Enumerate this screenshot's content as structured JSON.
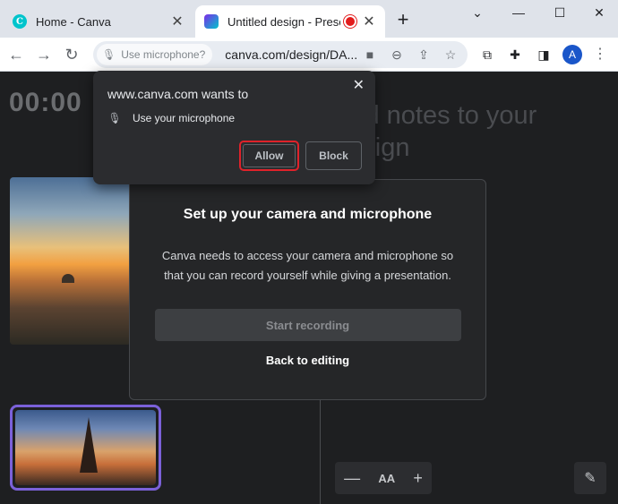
{
  "browser": {
    "tabs": [
      {
        "title": "Home - Canva",
        "favicon": "canva-logo-icon",
        "active": false
      },
      {
        "title": "Untitled design - Presen",
        "favicon": "canva-design-icon",
        "active": true,
        "recording_indicator": true
      }
    ],
    "new_tab_label": "+",
    "window_controls": {
      "minimize": "—",
      "maximize": "☐",
      "close": "✕",
      "tab_search": "⌄"
    },
    "nav": {
      "back": "←",
      "forward": "→",
      "reload": "↻"
    },
    "omnibox": {
      "mic_chip_label": "Use microphone?",
      "url": "canva.com/design/DA..."
    },
    "profile_initial": "A"
  },
  "permission_popup": {
    "host": "www.canva.com wants to",
    "request": "Use your microphone",
    "allow_label": "Allow",
    "block_label": "Block",
    "close_label": "✕",
    "highlight_color": "#e0222a"
  },
  "presenter": {
    "timer": "00:00",
    "notes_placeholder": "Add notes to your design",
    "font_controls": {
      "decrease": "—",
      "aa": "AA",
      "increase": "+"
    },
    "accent_color": "#7b61d9"
  },
  "camera_dialog": {
    "title": "Set up your camera and microphone",
    "body": "Canva needs to access your camera and microphone so that you can record yourself while giving a presentation.",
    "start_recording_label": "Start recording",
    "back_to_editing_label": "Back to editing"
  }
}
